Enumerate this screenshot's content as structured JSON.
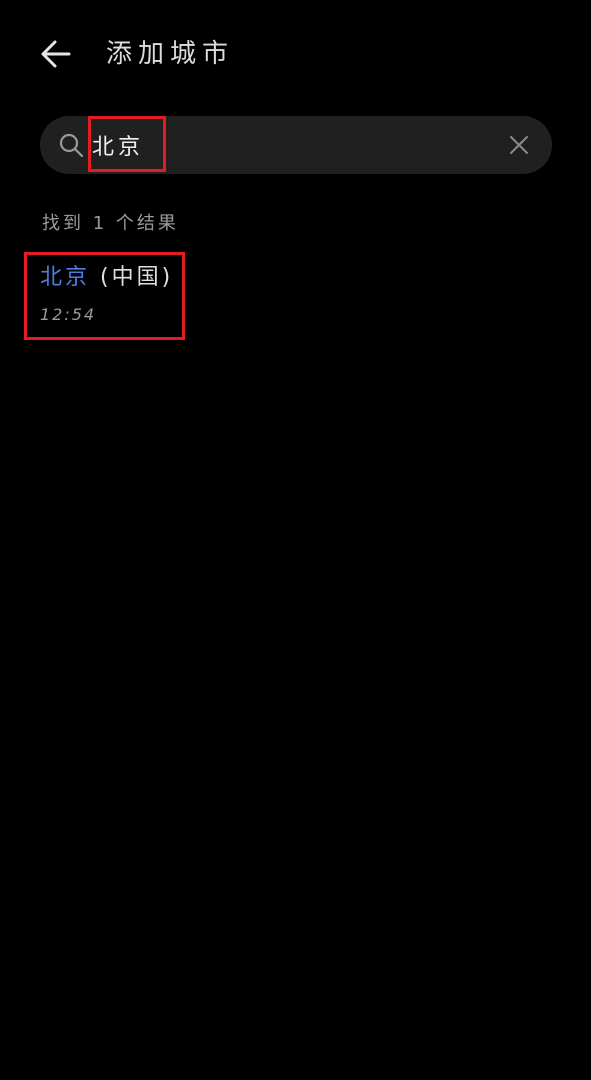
{
  "header": {
    "title": "添加城市",
    "back_icon": "arrow-left-icon"
  },
  "search": {
    "value": "北京",
    "placeholder": "",
    "search_icon": "search-icon",
    "clear_icon": "close-icon"
  },
  "results": {
    "count_text": "找到 1 个结果",
    "items": [
      {
        "city": "北京",
        "country": " (中国)",
        "time": "12:54"
      }
    ]
  },
  "colors": {
    "background": "#000000",
    "search_bg": "#202020",
    "accent": "#4d7fe3",
    "highlight": "#e31b23"
  }
}
